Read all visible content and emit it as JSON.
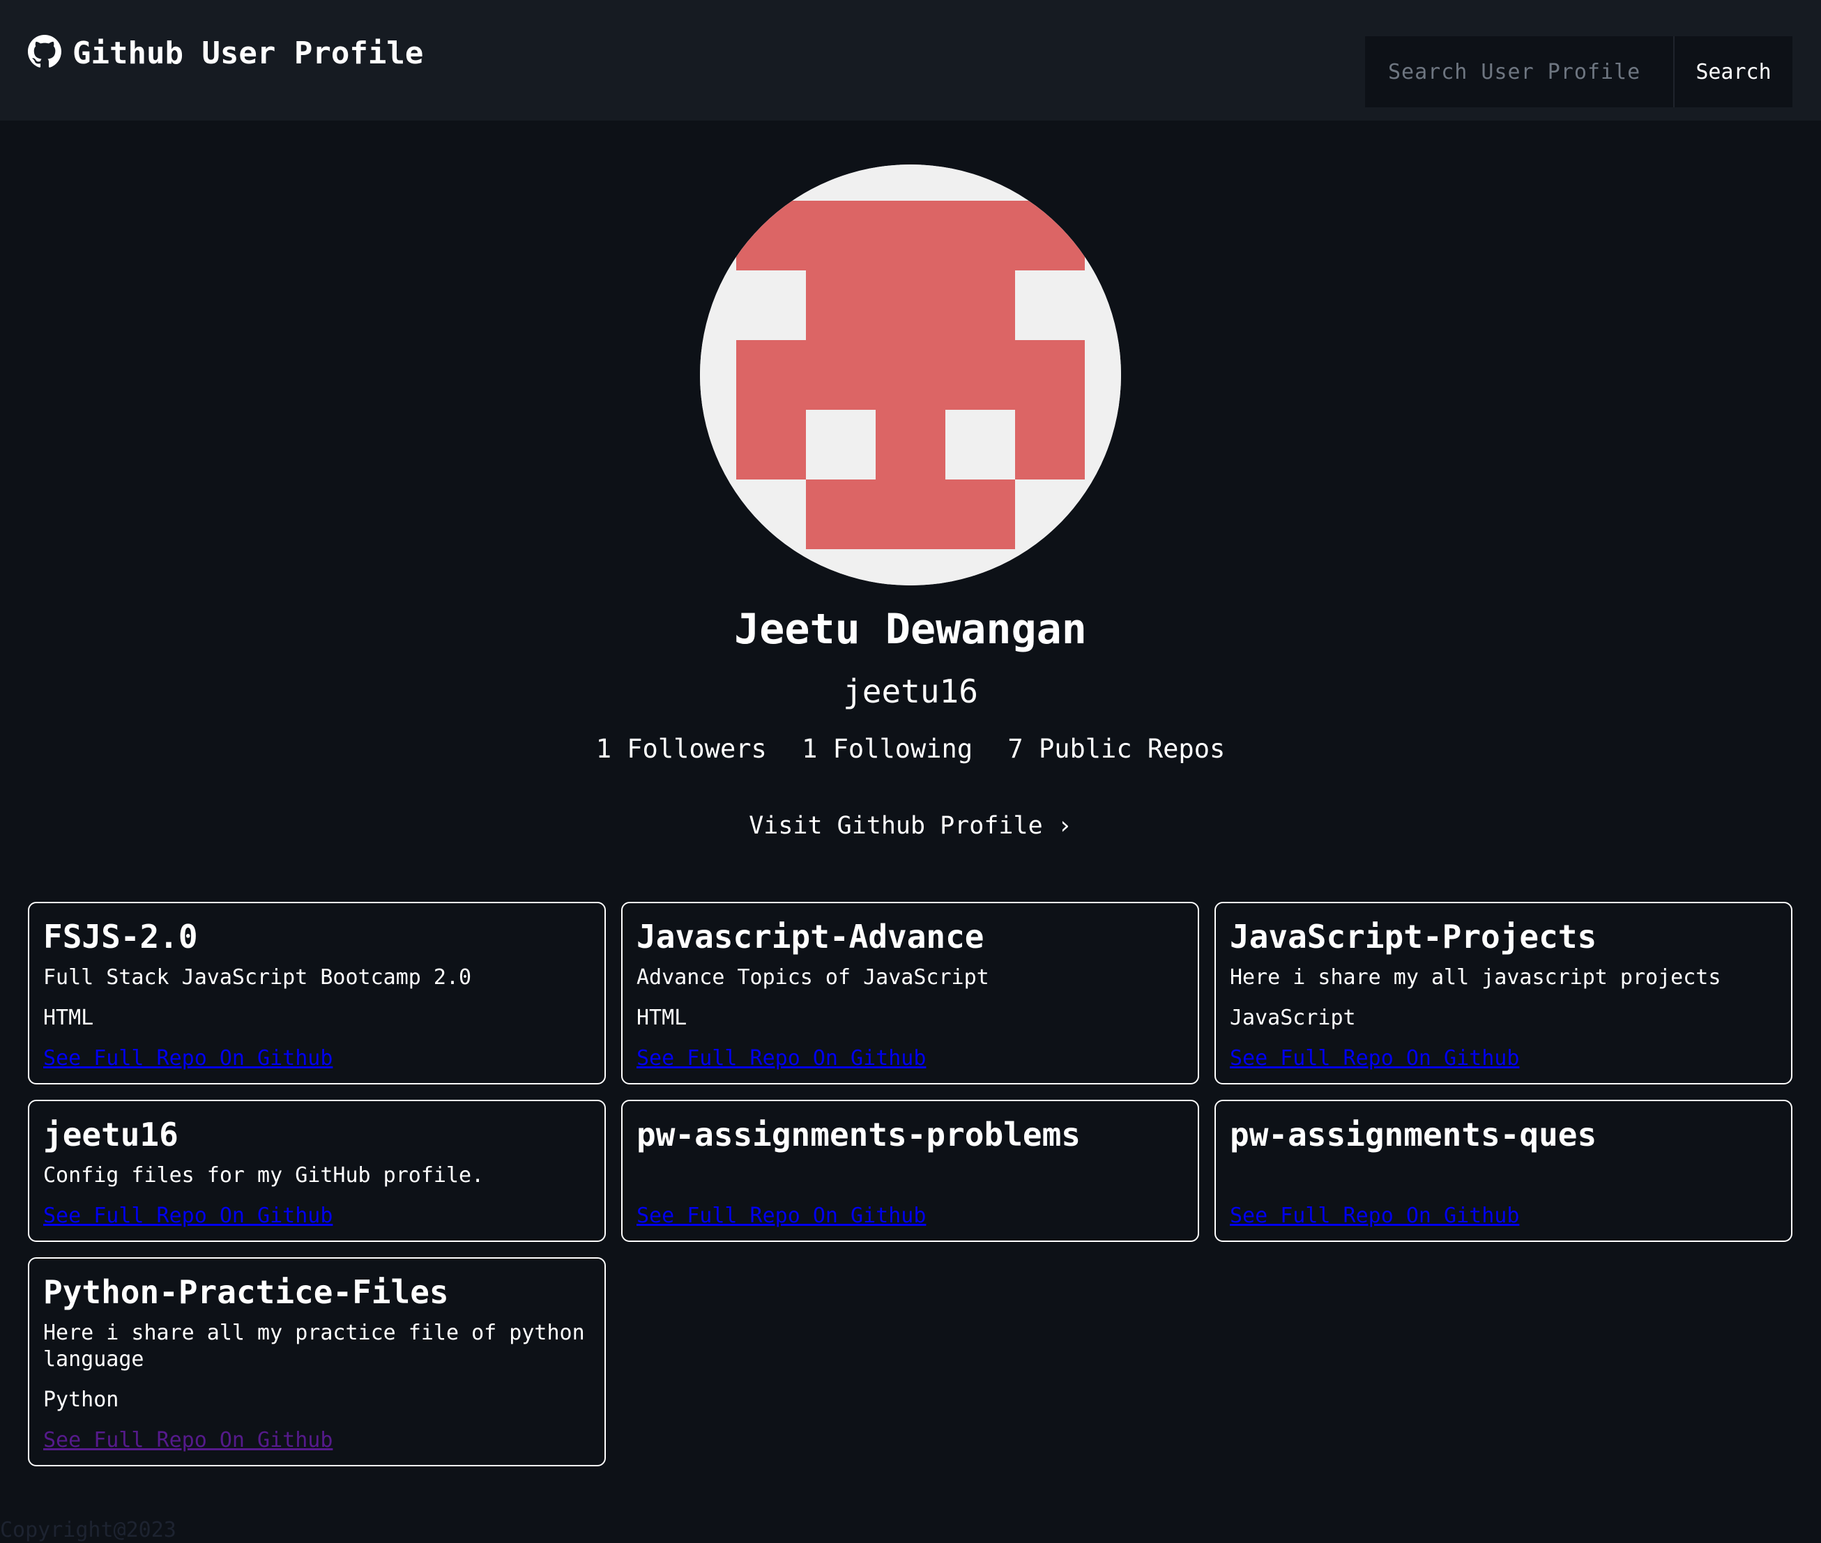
{
  "navbar": {
    "brand_icon": "github-icon",
    "title": "Github User Profile",
    "search_placeholder": "Search User Profile",
    "search_value": "",
    "search_button": "Search"
  },
  "profile": {
    "avatar_color": "#dc6565",
    "name": "Jeetu Dewangan",
    "login": "jeetu16",
    "followers": "1 Followers",
    "following": "1 Following",
    "repos": "7 Public Repos",
    "visit_link": "Visit Github Profile",
    "visit_icon": "chevron-right-icon"
  },
  "repos": [
    {
      "name": "FSJS-2.0",
      "description": "Full Stack JavaScript Bootcamp 2.0",
      "language": "HTML",
      "link": "See Full Repo On Github"
    },
    {
      "name": "Javascript-Advance",
      "description": "Advance Topics of JavaScript",
      "language": "HTML",
      "link": "See Full Repo On Github"
    },
    {
      "name": "JavaScript-Projects",
      "description": "Here i share my all javascript projects",
      "language": "JavaScript",
      "link": "See Full Repo On Github"
    },
    {
      "name": "jeetu16",
      "description": "Config files for my GitHub profile.",
      "language": "",
      "link": "See Full Repo On Github"
    },
    {
      "name": "pw-assignments-problems",
      "description": "",
      "language": "",
      "link": "See Full Repo On Github"
    },
    {
      "name": "pw-assignments-ques",
      "description": "",
      "language": "",
      "link": "See Full Repo On Github"
    },
    {
      "name": "Python-Practice-Files",
      "description": "Here i share all my practice file of python language",
      "language": "Python",
      "link": "See Full Repo On Github"
    }
  ],
  "footer": {
    "copyright": "Copyright@2023"
  }
}
